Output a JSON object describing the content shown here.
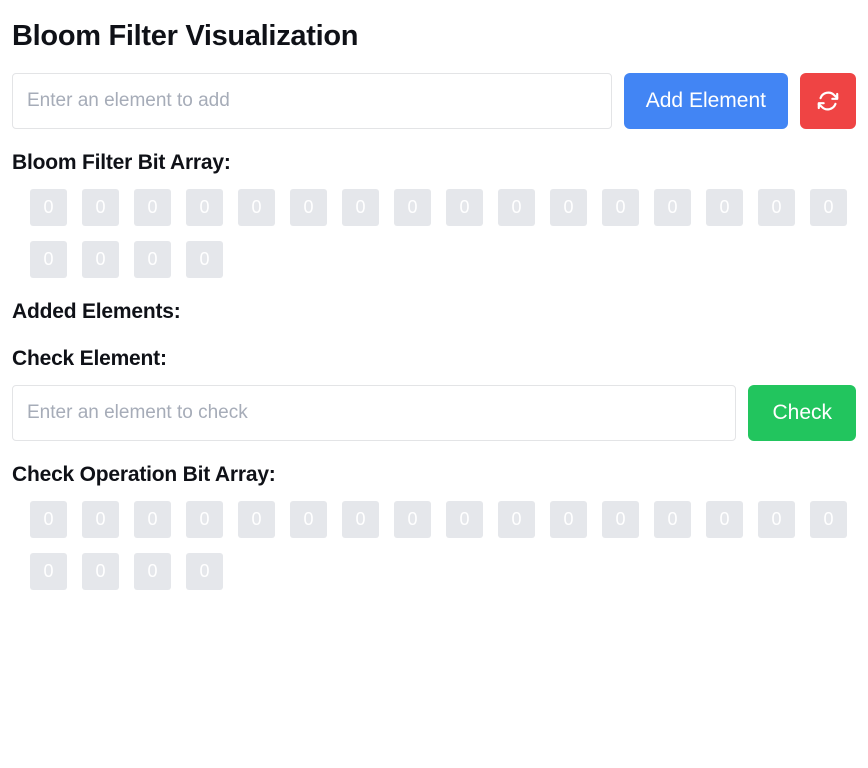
{
  "page": {
    "title": "Bloom Filter Visualization"
  },
  "add_section": {
    "input_placeholder": "Enter an element to add",
    "input_value": "",
    "add_button_label": "Add Element",
    "reset_icon": "refresh-icon",
    "add_button_color": "#4285f4",
    "reset_button_color": "#ef4444"
  },
  "bit_array_section": {
    "heading": "Bloom Filter Bit Array:",
    "size": 20,
    "bits": [
      0,
      0,
      0,
      0,
      0,
      0,
      0,
      0,
      0,
      0,
      0,
      0,
      0,
      0,
      0,
      0,
      0,
      0,
      0,
      0
    ],
    "cell_color": "#e5e7eb",
    "cell_text_color": "#ffffff"
  },
  "added_elements_section": {
    "heading": "Added Elements:",
    "items": []
  },
  "check_section": {
    "heading": "Check Element:",
    "input_placeholder": "Enter an element to check",
    "input_value": "",
    "check_button_label": "Check",
    "check_button_color": "#22c55e",
    "result_text": ""
  },
  "check_bit_array_section": {
    "heading": "Check Operation Bit Array:",
    "size": 20,
    "bits": [
      0,
      0,
      0,
      0,
      0,
      0,
      0,
      0,
      0,
      0,
      0,
      0,
      0,
      0,
      0,
      0,
      0,
      0,
      0,
      0
    ],
    "cell_color": "#e5e7eb",
    "cell_text_color": "#ffffff"
  }
}
